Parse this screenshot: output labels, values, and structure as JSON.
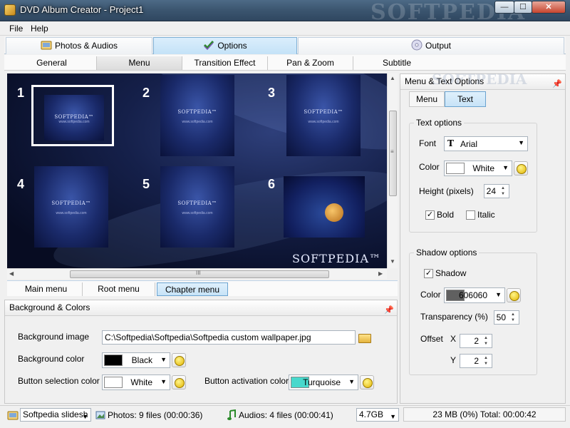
{
  "window": {
    "title": "DVD Album Creator - Project1",
    "watermark": "SOFTPEDIA",
    "buttons": {
      "minimize": "—",
      "maximize": "☐",
      "close": "✕"
    }
  },
  "menubar": {
    "file": "File",
    "help": "Help"
  },
  "main_tabs": [
    {
      "label": "Photos & Audios",
      "icon": "photos-audios-icon"
    },
    {
      "label": "Options",
      "icon": "checkmark-icon",
      "active": true
    },
    {
      "label": "Output",
      "icon": "disc-icon"
    }
  ],
  "sub_tabs": [
    {
      "label": "General"
    },
    {
      "label": "Menu",
      "active": true
    },
    {
      "label": "Transition Effect"
    },
    {
      "label": "Pan & Zoom"
    },
    {
      "label": "Subtitle"
    }
  ],
  "preview": {
    "thumbs": [
      {
        "num": "1",
        "brand": "SOFTPEDIA™",
        "sub": "www.softpedia.com",
        "selected": true
      },
      {
        "num": "2",
        "brand": "SOFTPEDIA™",
        "sub": "www.softpedia.com"
      },
      {
        "num": "3",
        "brand": "SOFTPEDIA™",
        "sub": "www.softpedia.com"
      },
      {
        "num": "4",
        "brand": "SOFTPEDIA™",
        "sub": "www.softpedia.com"
      },
      {
        "num": "5",
        "brand": "SOFTPEDIA™",
        "sub": "www.softpedia.com"
      },
      {
        "num": "6",
        "brand": "",
        "sub": ""
      }
    ],
    "brandmark": "SOFTPEDIA™",
    "scroll_grip": "III",
    "vscroll_grip": "≡"
  },
  "menu_tabs": [
    {
      "label": "Main menu"
    },
    {
      "label": "Root menu"
    },
    {
      "label": "Chapter menu",
      "active": true
    }
  ],
  "bg_panel": {
    "title": "Background & Colors",
    "background_image_label": "Background image",
    "background_image_value": "C:\\Softpedia\\Softpedia\\Softpedia custom wallpaper.jpg",
    "background_color_label": "Background color",
    "background_color": {
      "name": "Black",
      "hex": "#000000"
    },
    "button_selection_label": "Button selection color",
    "button_selection_color": {
      "name": "White",
      "hex": "#ffffff"
    },
    "button_activation_label": "Button activation color",
    "button_activation_color": {
      "name": "Turquoise",
      "hex": "#48d8cc"
    }
  },
  "right_panel": {
    "title": "Menu & Text Options",
    "watermark": "SOFTPEDIA",
    "tabs": [
      {
        "label": "Menu"
      },
      {
        "label": "Text",
        "active": true
      }
    ],
    "text_options": {
      "title": "Text options",
      "font_label": "Font",
      "font_value": "Arial",
      "color_label": "Color",
      "color": {
        "name": "White",
        "hex": "#ffffff"
      },
      "height_label": "Height (pixels)",
      "height_value": "24",
      "bold_label": "Bold",
      "bold_checked": true,
      "italic_label": "Italic",
      "italic_checked": false
    },
    "shadow_options": {
      "title": "Shadow options",
      "shadow_label": "Shadow",
      "shadow_checked": true,
      "color_label": "Color",
      "color": {
        "name": "606060",
        "hex": "#606060"
      },
      "transparency_label": "Transparency (%)",
      "transparency_value": "50",
      "offset_label": "Offset",
      "x_label": "X",
      "x_value": "2",
      "y_label": "Y",
      "y_value": "2"
    }
  },
  "statusbar": {
    "project_combo": "Softpedia slidesh",
    "photos": "Photos: 9 files (00:00:36)",
    "audios": "Audios: 4 files (00:00:41)",
    "disc_size": "4.7GB",
    "usage": "23 MB (0%)  Total: 00:00:42"
  }
}
